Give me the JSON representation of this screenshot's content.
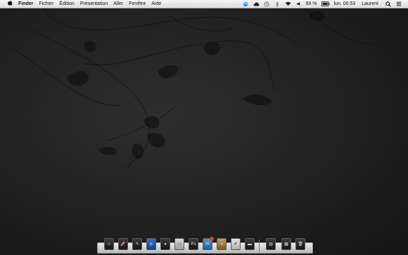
{
  "menubar": {
    "apple_icon": "apple-icon",
    "app_name": "Finder",
    "menus": [
      "Fichier",
      "Édition",
      "Présentation",
      "Aller",
      "Fenêtre",
      "Aide"
    ],
    "status_icons": [
      "sync-icon",
      "cloud-icon",
      "time-machine-icon",
      "bluetooth-icon",
      "wifi-icon",
      "volume-icon"
    ],
    "battery_percent": "99 %",
    "battery_icon": "battery-icon",
    "clock": "lun. 00:53",
    "user": "Laurent",
    "spotlight_icon": "search-icon",
    "list_icon": "list-icon"
  },
  "dock": {
    "apps": [
      {
        "name": "finder-icon",
        "glyph": "☺"
      },
      {
        "name": "launchpad-icon",
        "glyph": "🚀"
      },
      {
        "name": "dashboard-icon",
        "glyph": "✎"
      },
      {
        "name": "safari-icon",
        "glyph": "◎"
      },
      {
        "name": "recorder-icon",
        "glyph": "●"
      },
      {
        "name": "preview-icon",
        "glyph": "▭"
      },
      {
        "name": "photoshop-icon",
        "glyph": "Ps"
      },
      {
        "name": "messages-icon",
        "glyph": "✉"
      },
      {
        "name": "notes-icon",
        "glyph": "≡"
      },
      {
        "name": "textedit-icon",
        "glyph": "✐"
      },
      {
        "name": "terminal-icon",
        "glyph": "▬"
      }
    ],
    "stacks": [
      {
        "name": "applications-stack-icon",
        "glyph": "▤"
      },
      {
        "name": "documents-stack-icon",
        "glyph": "▦"
      },
      {
        "name": "trash-icon",
        "glyph": "🗑"
      }
    ],
    "notification_badge": "",
    "accent_color": "#e23b2f"
  }
}
